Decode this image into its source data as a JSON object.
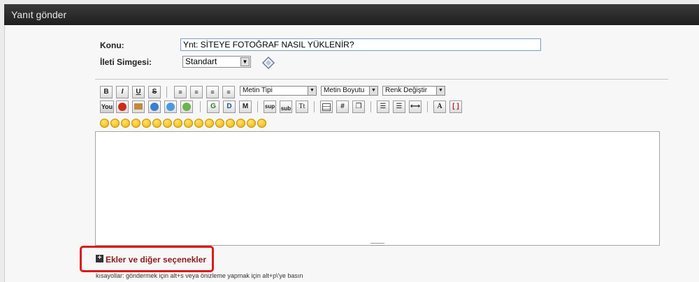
{
  "header": {
    "title": "Yanıt gönder"
  },
  "form": {
    "subject_label": "Konu:",
    "subject_value": "Ynt: SİTEYE FOTOĞRAF NASIL YÜKLENİR?",
    "icon_label": "İleti Simgesi:",
    "icon_select_value": "Standart"
  },
  "toolbar": {
    "bold": "B",
    "italic": "I",
    "underline": "U",
    "strike": "S",
    "font_select": "Metin Tipi",
    "size_select": "Metin Boyutu",
    "color_select": "Renk Değiştir",
    "youtube": "You",
    "google": "G",
    "dailymotion": "D",
    "msn": "M",
    "sup": "sup",
    "sub": "sub",
    "tt": "Tt",
    "hash": "#",
    "font_a": "A"
  },
  "smileys": {
    "count": 16
  },
  "attachments": {
    "label": "Ekler ve diğer seçenekler"
  },
  "shortcuts": {
    "text": "kısayollar: göndermek için alt+s veya önizleme yapmak için alt+p\\'ye basın"
  },
  "colors": {
    "header_bg": "#262626",
    "link": "#8b1a1a",
    "highlight": "#e01818"
  }
}
